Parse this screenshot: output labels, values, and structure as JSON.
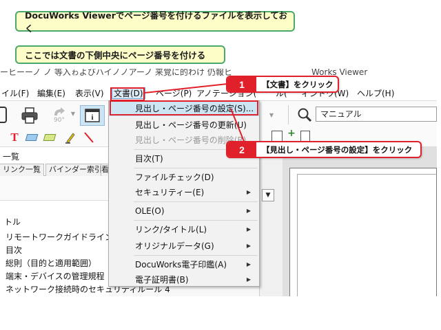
{
  "instructions": {
    "step_a": "DocuWorks Viewerでページ番号を付けるファイルを表示しておく",
    "step_b": "ここでは文書の下側中央にページ番号を付ける"
  },
  "window": {
    "title_left": "ーヒーーノ ノ 等入ゎよびハイノノアーノ 来覚に的わけ 仍報ヒ",
    "title_right": "Works Viewer"
  },
  "menubar": {
    "items": [
      "イル(F)",
      "編集(E)",
      "表示(V)",
      "文書(D)",
      "ページ(P)",
      "アノテーション(",
      "ル(",
      "ィンドウ(W)",
      "ヘルプ(H)"
    ]
  },
  "toolbar": {
    "zoom_label": "90°",
    "search_value": "マニュアル"
  },
  "left_panel": {
    "title": "一覧",
    "tabs": [
      "リンク一覧",
      "バインダー索引",
      "看"
    ],
    "outline": [
      "トル",
      "リモートワークガイドライン表紙",
      "目次",
      "総則（目的と適用範囲）",
      "端末・デバイスの管理規程",
      "ネットワーク接続時のセキュリティルール 4"
    ]
  },
  "dropdown": {
    "items": [
      {
        "label": "見出し・ページ番号の設定(S)...",
        "state": "highlighted",
        "submenu": false
      },
      {
        "label": "見出し・ページ番号の更新(U)",
        "state": "normal",
        "submenu": false
      },
      {
        "label": "見出し・ページ番号の削除(R)",
        "state": "disabled",
        "submenu": false
      },
      {
        "label": "目次(T)",
        "state": "normal",
        "submenu": false
      },
      {
        "label": "ファイルチェック(D)",
        "state": "normal",
        "submenu": false
      },
      {
        "label": "セキュリティー(E)",
        "state": "normal",
        "submenu": true
      },
      {
        "label": "OLE(O)",
        "state": "normal",
        "submenu": true
      },
      {
        "label": "リンク/タイトル(L)",
        "state": "normal",
        "submenu": true
      },
      {
        "label": "オリジナルデータ(G)",
        "state": "normal",
        "submenu": true
      },
      {
        "label": "DocuWorks電子印鑑(A)",
        "state": "normal",
        "submenu": true
      },
      {
        "label": "電子証明書(B)",
        "state": "normal",
        "submenu": true
      }
    ]
  },
  "callouts": [
    {
      "number": "1",
      "text": "【文書】をクリック"
    },
    {
      "number": "2",
      "text": "【見出し・ページ番号の設定】をクリック"
    }
  ],
  "colors": {
    "accent_red": "#e0202a",
    "instruction_bg": "#fdfdc8",
    "instruction_border": "#4aa86a",
    "highlight_blue": "#cde4f3"
  }
}
